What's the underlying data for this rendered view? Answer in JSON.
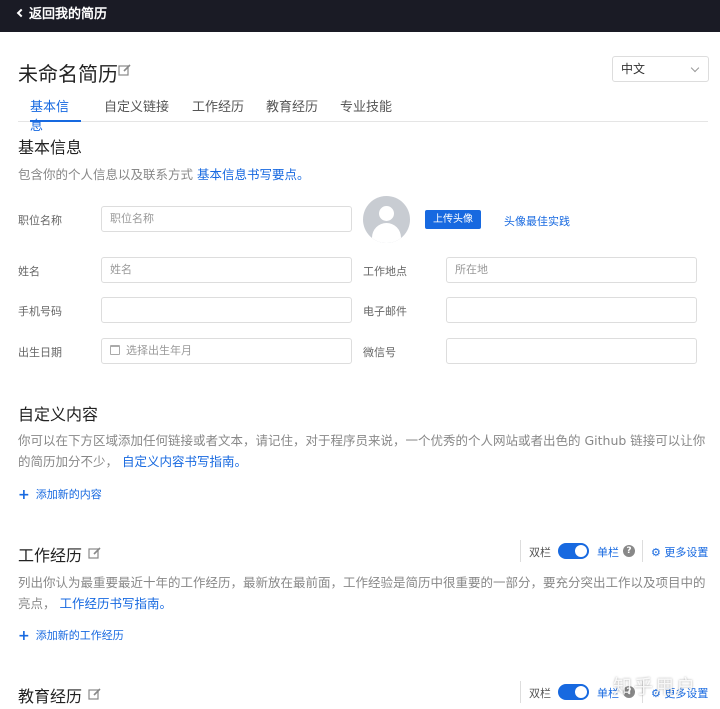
{
  "topbar": {
    "back_label": "返回我的简历"
  },
  "header": {
    "title": "未命名简历",
    "language": "中文"
  },
  "tabs": [
    "基本信息",
    "自定义链接",
    "工作经历",
    "教育经历",
    "专业技能"
  ],
  "basic": {
    "title": "基本信息",
    "desc_text": "包含你的个人信息以及联系方式 ",
    "desc_link": "基本信息书写要点。",
    "fields": {
      "position_label": "职位名称",
      "position_placeholder": "职位名称",
      "name_label": "姓名",
      "name_placeholder": "姓名",
      "location_label": "工作地点",
      "location_placeholder": "所在地",
      "phone_label": "手机号码",
      "email_label": "电子邮件",
      "birth_label": "出生日期",
      "birth_placeholder": "选择出生年月",
      "wechat_label": "微信号"
    },
    "upload_label": "上传头像",
    "avatar_tip": "头像最佳实践"
  },
  "custom": {
    "title": "自定义内容",
    "desc_line1": "你可以在下方区域添加任何链接或者文本，请记住，对于程序员来说，一个优秀的个人网站或者出色的 Github 链接可以让你",
    "desc_line2": "的简历加分不少， ",
    "desc_link": "自定义内容书写指南。",
    "add_label": "添加新的内容"
  },
  "work": {
    "title": "工作经历",
    "desc_line1": "列出你认为最重要最近十年的工作经历，最新放在最前面，工作经验是简历中很重要的一部分，要充分突出工作以及项目中的",
    "desc_line2": "亮点， ",
    "desc_link": "工作经历书写指南。",
    "add_label": "添加新的工作经历"
  },
  "education": {
    "title": "教育经历"
  },
  "controls": {
    "double_col": "双栏",
    "single_col": "单栏",
    "more_settings": "更多设置",
    "help": "?"
  },
  "watermark": "知乎用户",
  "colors": {
    "accent": "#1769e0",
    "topbar": "#1a1b25"
  }
}
